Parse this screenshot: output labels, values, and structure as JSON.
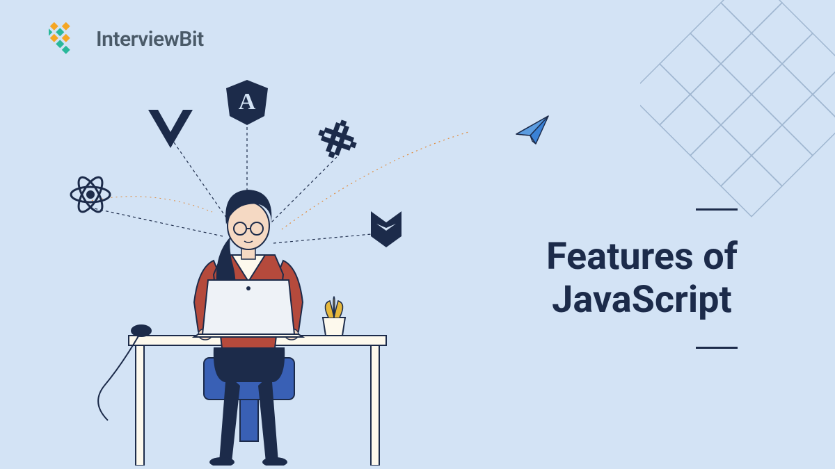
{
  "brand": {
    "name": "InterviewBit"
  },
  "title": {
    "line1": "Features of",
    "line2": "JavaScript"
  },
  "frameworks": {
    "react": "react-icon",
    "vue": "vue-icon",
    "angular": "angular-icon",
    "aurelia": "aurelia-icon",
    "backbone": "backbone-icon"
  }
}
